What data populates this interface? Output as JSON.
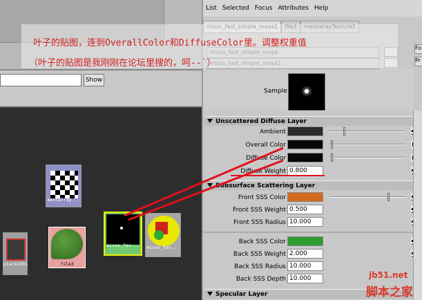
{
  "annotation": {
    "line1": "叶子的贴图，连到OverallColor和DiffuseColor里。调整权重值",
    "line2": "（叶子的贴图是我刚刚在论坛里搜的，呵--`）"
  },
  "left_panel": {
    "show_button": "Show"
  },
  "graph_nodes": {
    "mentalray": "mentalray...",
    "place2d": "place2dTe...",
    "file3": "file3",
    "misss1": "misss_fas...",
    "misss2": "misss_fas..."
  },
  "menubar": [
    "List",
    "Selected",
    "Focus",
    "Attributes",
    "Help"
  ],
  "tabs": [
    "misss_fast_simple_maya1",
    "file3",
    "mentalrayTexture1"
  ],
  "type_rows": {
    "row1": "misss_fast_simple_maya",
    "row2": "misss_fast_simple_maya1"
  },
  "right_buttons": {
    "focus": "Fo",
    "presets": "Pr"
  },
  "sample": {
    "label": "Sample"
  },
  "sections": {
    "unscattered": "Unscattered Diffuse Layer",
    "subsurface": "Subsurface Scattering Layer",
    "specular": "Specular Layer"
  },
  "attributes": {
    "ambient": {
      "label": "Ambient",
      "color": "#2a2a2a"
    },
    "overall_color": {
      "label": "Overall Color",
      "color": "#050505"
    },
    "diffuse_color": {
      "label": "Diffuse Color",
      "color": "#050505"
    },
    "diffuse_weight": {
      "label": "Diffuse Weight",
      "value": "0.800"
    },
    "front_sss_color": {
      "label": "Front SSS Color",
      "color": "#d2691e"
    },
    "front_sss_weight": {
      "label": "Front SSS Weight",
      "value": "0.500"
    },
    "front_sss_radius": {
      "label": "Front SSS Radius",
      "value": "10.000"
    },
    "back_sss_color": {
      "label": "Back SSS Color",
      "color": "#2e9c2e"
    },
    "back_sss_weight": {
      "label": "Back SSS Weight",
      "value": "2.000"
    },
    "back_sss_radius": {
      "label": "Back SSS Radius",
      "value": "10.000"
    },
    "back_sss_depth": {
      "label": "Back SSS Depth",
      "value": "10.000"
    }
  },
  "watermark": {
    "site": "jb51.net",
    "name": "脚本之家"
  },
  "colors": {
    "annotation_red": "#d62020",
    "connection_red": "#e0101a"
  }
}
